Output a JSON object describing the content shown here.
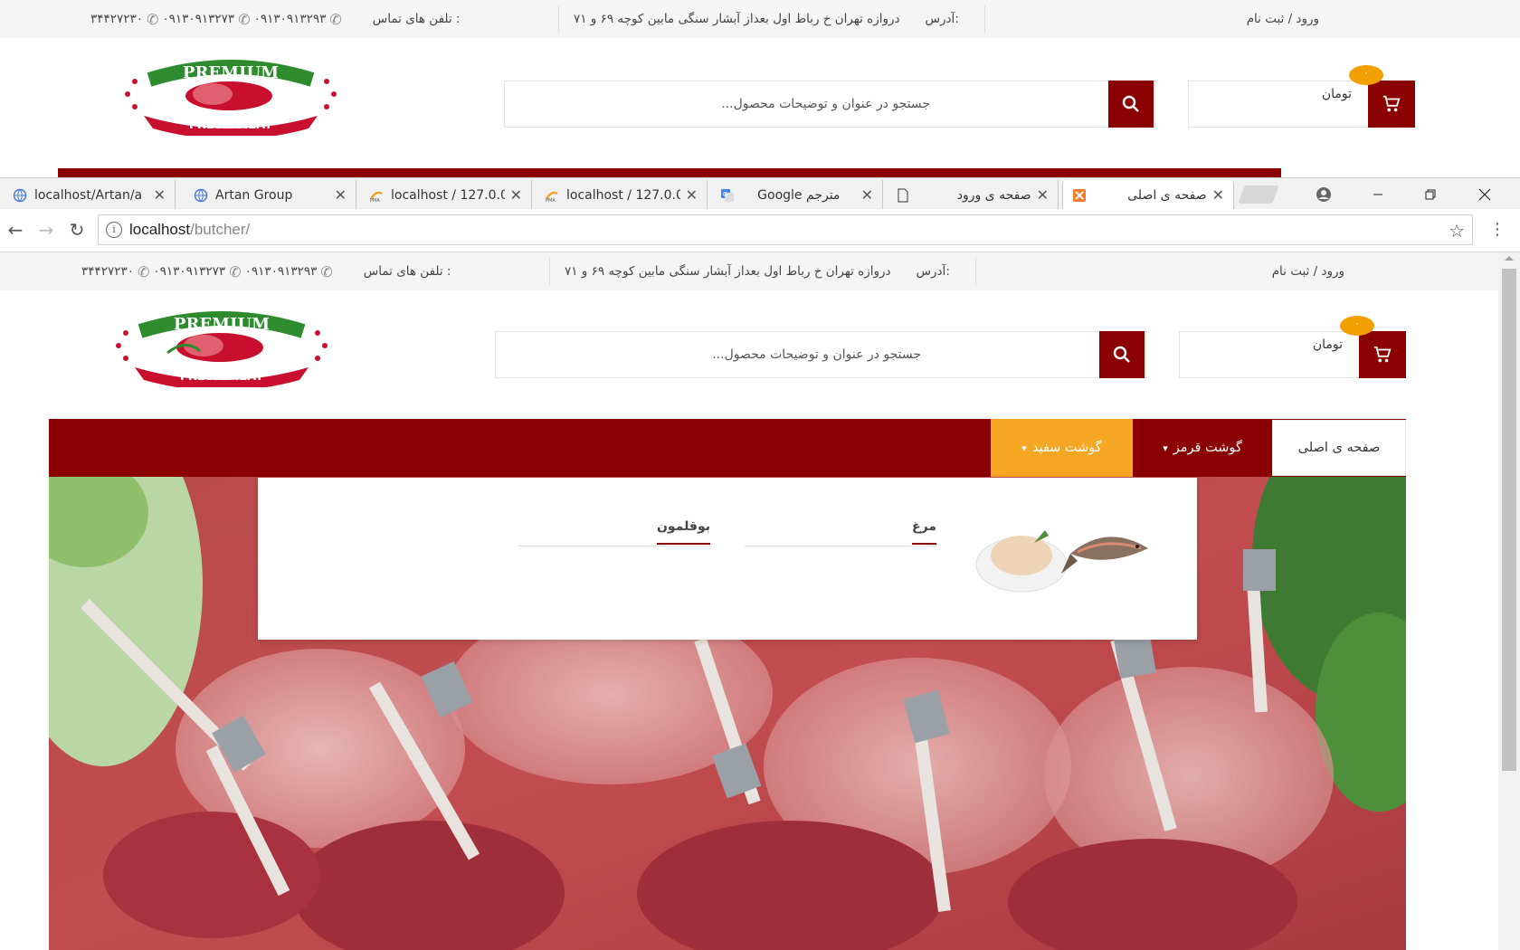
{
  "site": {
    "login_register": "ورود / ثبت نام",
    "address_label": "آدرس:",
    "address_text": "دروازه تهران خ رباط اول بعداز آبشار سنگی مابین کوچه ۶۹ و ۷۱",
    "phones_label": "تلفن های تماس :",
    "phone_1": "۰۹۱۳۰۹۱۳۲۹۳",
    "phone_2": "۰۹۱۳۰۹۱۳۲۷۳",
    "phone_3": "۳۴۴۲۷۲۳۰",
    "search_placeholder": "جستجو در عنوان و توضیحات محصول...",
    "cart_count": "۰",
    "cart_total_label": "تومان",
    "logo_top_text": "PREMIUM",
    "logo_bottom_text": "FRESH MEAT"
  },
  "browser": {
    "tabs": [
      {
        "label": "localhost/Artan/a",
        "icon": "globe-icon"
      },
      {
        "label": "Artan Group",
        "icon": "globe-icon"
      },
      {
        "label": "localhost / 127.0.0",
        "icon": "phpmyadmin-icon"
      },
      {
        "label": "localhost / 127.0.0",
        "icon": "phpmyadmin-icon"
      },
      {
        "label": "Google مترجم",
        "icon": "google-translate-icon"
      },
      {
        "label": "صفحه ی ورود",
        "icon": "document-icon"
      },
      {
        "label": "صفحه ی اصلی",
        "icon": "xampp-icon"
      }
    ],
    "url_host": "localhost",
    "url_path": "/butcher/"
  },
  "nav": {
    "home": "صفحه ی اصلی",
    "red_meat": "گوشت قرمز",
    "white_meat": "گوشت سفید"
  },
  "dropdown": {
    "links": [
      "مرغ",
      "بوقلمون"
    ]
  },
  "colors": {
    "brand": "#8b0000",
    "accent": "#f5a623",
    "badge": "#f2a000"
  }
}
